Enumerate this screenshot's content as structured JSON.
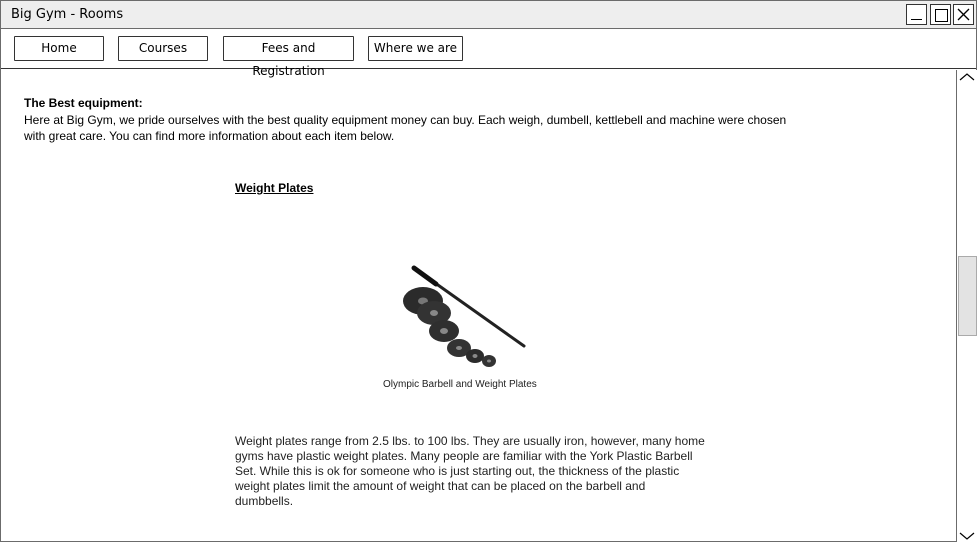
{
  "window": {
    "title": "Big Gym - Rooms"
  },
  "nav": {
    "home": "Home",
    "courses": "Courses",
    "fees": "Fees and Registration",
    "where": "Where we are"
  },
  "intro": {
    "heading": "The Best equipment:",
    "text": "Here at Big Gym, we pride ourselves with the best quality equipment money can buy. Each weigh, dumbell, kettlebell and machine were chosen with great care. You can find more information about each item below."
  },
  "section": {
    "title": "Weight Plates",
    "image_caption": "Olympic Barbell and Weight Plates",
    "body": "Weight plates range from 2.5 lbs. to 100 lbs. They are usually iron, however, many home gyms have plastic weight plates. Many people are familiar with the York Plastic Barbell Set. While this is ok for someone who is just starting out, the thickness of the plastic weight plates limit the amount of weight that can be placed on the barbell and dumbbells."
  },
  "icons": {
    "minimize": "minimize-icon",
    "maximize": "maximize-icon",
    "close": "close-icon",
    "scroll_up": "chevron-up-icon",
    "scroll_down": "chevron-down-icon"
  }
}
